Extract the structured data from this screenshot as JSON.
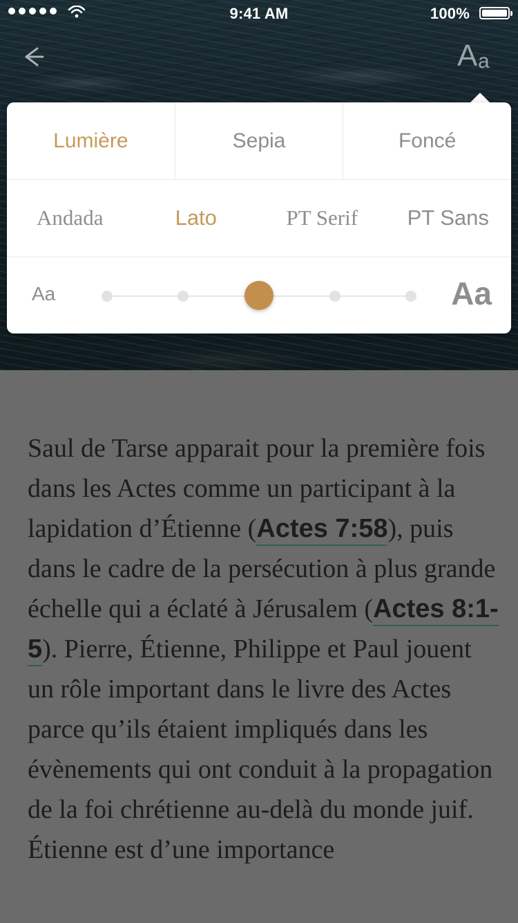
{
  "status_bar": {
    "time": "9:41 AM",
    "battery_percent": "100%"
  },
  "header": {
    "back_icon": "arrow-left-icon",
    "font_settings_label": {
      "big": "A",
      "small": "a"
    }
  },
  "popover": {
    "themes": [
      "Lumière",
      "Sepia",
      "Foncé"
    ],
    "active_theme_index": 0,
    "fonts": [
      "Andada",
      "Lato",
      "PT Serif",
      "PT Sans"
    ],
    "active_font_index": 1,
    "font_size": {
      "small_label": "Aa",
      "large_label": "Aa",
      "steps": 5,
      "selected_step_index": 2
    }
  },
  "article": {
    "text_1": "Saul de Tarse apparait pour la première fois dans les Actes comme un participant à la lapidation d’Étienne (",
    "ref_1": "Actes 7:58",
    "text_2": "), puis dans le cadre de la persécution à plus grande échelle qui a éclaté à Jérusalem (",
    "ref_2": "Actes 8:1-5",
    "text_3": "). Pierre, Étienne, Philippe et Paul jouent un rôle important dans le livre des Actes parce qu’ils étaient impliqués dans les évènements qui ont conduit à la propagation de la foi chrétienne au-delà du monde juif. Étienne est d’une importance"
  },
  "colors": {
    "accent": "#c59a5a",
    "thumb": "#c38f4c",
    "muted": "#8e8e8e",
    "link_underline": "#2f5e52"
  }
}
